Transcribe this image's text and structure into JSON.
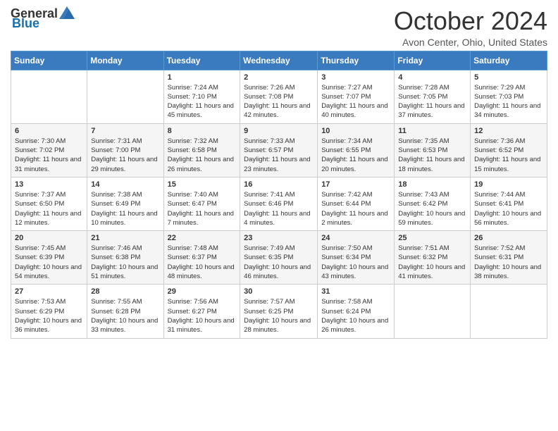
{
  "header": {
    "logo_general": "General",
    "logo_blue": "Blue",
    "month": "October 2024",
    "location": "Avon Center, Ohio, United States"
  },
  "days_of_week": [
    "Sunday",
    "Monday",
    "Tuesday",
    "Wednesday",
    "Thursday",
    "Friday",
    "Saturday"
  ],
  "weeks": [
    [
      {
        "day": "",
        "info": ""
      },
      {
        "day": "",
        "info": ""
      },
      {
        "day": "1",
        "info": "Sunrise: 7:24 AM\nSunset: 7:10 PM\nDaylight: 11 hours and 45 minutes."
      },
      {
        "day": "2",
        "info": "Sunrise: 7:26 AM\nSunset: 7:08 PM\nDaylight: 11 hours and 42 minutes."
      },
      {
        "day": "3",
        "info": "Sunrise: 7:27 AM\nSunset: 7:07 PM\nDaylight: 11 hours and 40 minutes."
      },
      {
        "day": "4",
        "info": "Sunrise: 7:28 AM\nSunset: 7:05 PM\nDaylight: 11 hours and 37 minutes."
      },
      {
        "day": "5",
        "info": "Sunrise: 7:29 AM\nSunset: 7:03 PM\nDaylight: 11 hours and 34 minutes."
      }
    ],
    [
      {
        "day": "6",
        "info": "Sunrise: 7:30 AM\nSunset: 7:02 PM\nDaylight: 11 hours and 31 minutes."
      },
      {
        "day": "7",
        "info": "Sunrise: 7:31 AM\nSunset: 7:00 PM\nDaylight: 11 hours and 29 minutes."
      },
      {
        "day": "8",
        "info": "Sunrise: 7:32 AM\nSunset: 6:58 PM\nDaylight: 11 hours and 26 minutes."
      },
      {
        "day": "9",
        "info": "Sunrise: 7:33 AM\nSunset: 6:57 PM\nDaylight: 11 hours and 23 minutes."
      },
      {
        "day": "10",
        "info": "Sunrise: 7:34 AM\nSunset: 6:55 PM\nDaylight: 11 hours and 20 minutes."
      },
      {
        "day": "11",
        "info": "Sunrise: 7:35 AM\nSunset: 6:53 PM\nDaylight: 11 hours and 18 minutes."
      },
      {
        "day": "12",
        "info": "Sunrise: 7:36 AM\nSunset: 6:52 PM\nDaylight: 11 hours and 15 minutes."
      }
    ],
    [
      {
        "day": "13",
        "info": "Sunrise: 7:37 AM\nSunset: 6:50 PM\nDaylight: 11 hours and 12 minutes."
      },
      {
        "day": "14",
        "info": "Sunrise: 7:38 AM\nSunset: 6:49 PM\nDaylight: 11 hours and 10 minutes."
      },
      {
        "day": "15",
        "info": "Sunrise: 7:40 AM\nSunset: 6:47 PM\nDaylight: 11 hours and 7 minutes."
      },
      {
        "day": "16",
        "info": "Sunrise: 7:41 AM\nSunset: 6:46 PM\nDaylight: 11 hours and 4 minutes."
      },
      {
        "day": "17",
        "info": "Sunrise: 7:42 AM\nSunset: 6:44 PM\nDaylight: 11 hours and 2 minutes."
      },
      {
        "day": "18",
        "info": "Sunrise: 7:43 AM\nSunset: 6:42 PM\nDaylight: 10 hours and 59 minutes."
      },
      {
        "day": "19",
        "info": "Sunrise: 7:44 AM\nSunset: 6:41 PM\nDaylight: 10 hours and 56 minutes."
      }
    ],
    [
      {
        "day": "20",
        "info": "Sunrise: 7:45 AM\nSunset: 6:39 PM\nDaylight: 10 hours and 54 minutes."
      },
      {
        "day": "21",
        "info": "Sunrise: 7:46 AM\nSunset: 6:38 PM\nDaylight: 10 hours and 51 minutes."
      },
      {
        "day": "22",
        "info": "Sunrise: 7:48 AM\nSunset: 6:37 PM\nDaylight: 10 hours and 48 minutes."
      },
      {
        "day": "23",
        "info": "Sunrise: 7:49 AM\nSunset: 6:35 PM\nDaylight: 10 hours and 46 minutes."
      },
      {
        "day": "24",
        "info": "Sunrise: 7:50 AM\nSunset: 6:34 PM\nDaylight: 10 hours and 43 minutes."
      },
      {
        "day": "25",
        "info": "Sunrise: 7:51 AM\nSunset: 6:32 PM\nDaylight: 10 hours and 41 minutes."
      },
      {
        "day": "26",
        "info": "Sunrise: 7:52 AM\nSunset: 6:31 PM\nDaylight: 10 hours and 38 minutes."
      }
    ],
    [
      {
        "day": "27",
        "info": "Sunrise: 7:53 AM\nSunset: 6:29 PM\nDaylight: 10 hours and 36 minutes."
      },
      {
        "day": "28",
        "info": "Sunrise: 7:55 AM\nSunset: 6:28 PM\nDaylight: 10 hours and 33 minutes."
      },
      {
        "day": "29",
        "info": "Sunrise: 7:56 AM\nSunset: 6:27 PM\nDaylight: 10 hours and 31 minutes."
      },
      {
        "day": "30",
        "info": "Sunrise: 7:57 AM\nSunset: 6:25 PM\nDaylight: 10 hours and 28 minutes."
      },
      {
        "day": "31",
        "info": "Sunrise: 7:58 AM\nSunset: 6:24 PM\nDaylight: 10 hours and 26 minutes."
      },
      {
        "day": "",
        "info": ""
      },
      {
        "day": "",
        "info": ""
      }
    ]
  ]
}
